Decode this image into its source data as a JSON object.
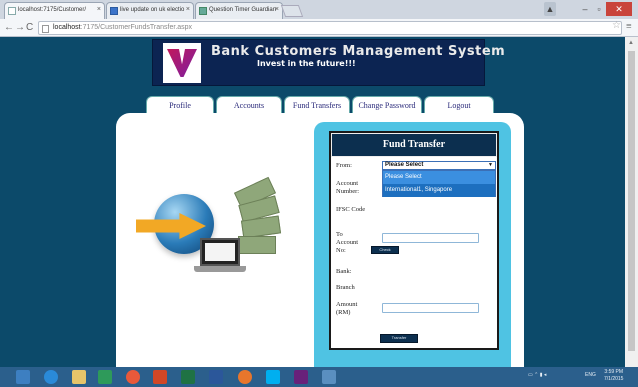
{
  "browser": {
    "tabs": [
      {
        "label": "localhost:7175/Customer/",
        "favicon": "page-icon"
      },
      {
        "label": "live update on uk electio",
        "favicon": "blue-app-icon"
      },
      {
        "label": "Question Timer Guardian",
        "favicon": "guardian-icon"
      }
    ],
    "url_host": "localhost",
    "url_path": ":7175/CustomerFundsTransfer.aspx"
  },
  "banner": {
    "title": "Bank Customers Management System",
    "subtitle": "Invest in the future!!!"
  },
  "nav": {
    "items": [
      "Profile",
      "Accounts",
      "Fund Transfers",
      "Change Password",
      "Logout"
    ]
  },
  "form": {
    "heading": "Fund Transfer",
    "from_label": "From:",
    "from_selected": "Please Select",
    "from_options": [
      "Please Select",
      "International1, Singapore"
    ],
    "account_number_label": "Account Number:",
    "ifsc_label": "IFSC Code",
    "to_account_label": "To Account No:",
    "bank_label": "Bank:",
    "branch_label": "Branch",
    "amount_label": "Amount (RM)",
    "check_button": "Check",
    "transfer_button": "Transfer"
  },
  "colors": {
    "page_background": "#0c4a6a",
    "panel_accent": "#4fc3e3",
    "header_navy": "#0c2f4f",
    "dropdown_highlight": "#3b8fe0"
  },
  "taskbar": {
    "language": "ENG",
    "time": "3:59 PM",
    "date": "7/1/2015"
  }
}
